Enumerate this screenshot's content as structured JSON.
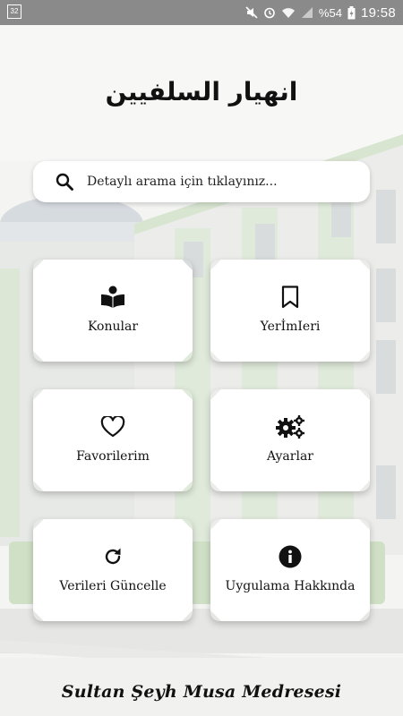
{
  "status_bar": {
    "left_badge": "32",
    "battery": "%54",
    "time": "19:58"
  },
  "header": {
    "title": "انهيار السلفيين"
  },
  "search": {
    "placeholder": "Detaylı arama için tıklayınız..."
  },
  "tiles": [
    {
      "label": "Konular",
      "icon": "book-reader-icon"
    },
    {
      "label": "YerİmIeri",
      "icon": "bookmark-icon"
    },
    {
      "label": "Favorilerim",
      "icon": "heart-icon"
    },
    {
      "label": "Ayarlar",
      "icon": "gears-icon"
    },
    {
      "label": "Verileri Güncelle",
      "icon": "refresh-icon"
    },
    {
      "label": "Uygulama Hakkında",
      "icon": "info-icon"
    }
  ],
  "footer": {
    "text": "Sultan Şeyh Musa Medresesi"
  },
  "colors": {
    "status_bar": "#8a8a8a",
    "background": "#f4f5f3",
    "tile": "#ffffff",
    "building_green": "#cfe0c6",
    "text": "#111111"
  }
}
